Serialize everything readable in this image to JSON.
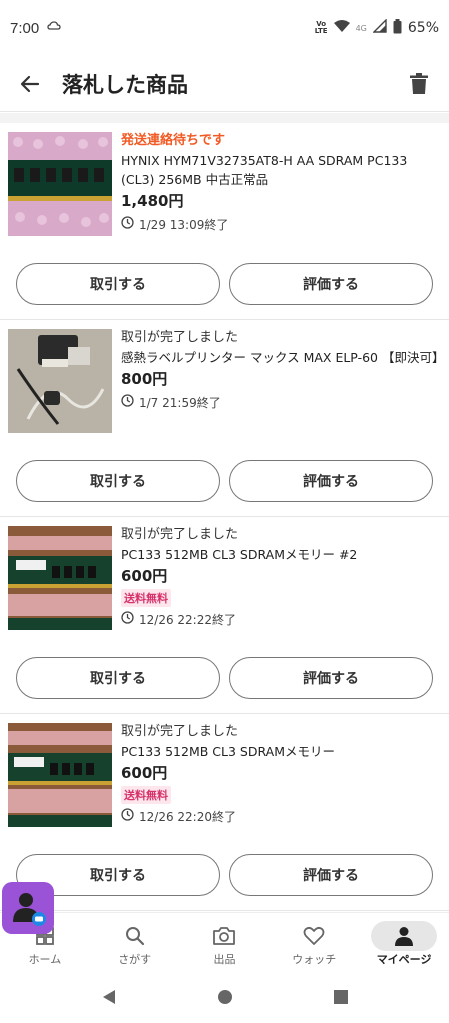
{
  "status_bar": {
    "time": "7:00",
    "lte_top": "Vo",
    "lte_bottom": "LTE",
    "network": "4G",
    "battery": "65%"
  },
  "header": {
    "title": "落札した商品"
  },
  "items": [
    {
      "status": "発送連絡待ちです",
      "name": "HYNIX HYM71V32735AT8-H AA SDRAM PC133 (CL3) 256MB 中古正常品",
      "price": "1,480円",
      "badge": "",
      "end": "1/29 13:09終了",
      "btn_trade": "取引する",
      "btn_rate": "評価する"
    },
    {
      "status": "取引が完了しました",
      "name": "感熱ラベルプリンター マックス MAX ELP-60 【即決可】",
      "price": "800円",
      "badge": "",
      "end": "1/7 21:59終了",
      "btn_trade": "取引する",
      "btn_rate": "評価する"
    },
    {
      "status": "取引が完了しました",
      "name": "PC133 512MB CL3 SDRAMメモリー #2",
      "price": "600円",
      "badge": "送料無料",
      "end": "12/26 22:22終了",
      "btn_trade": "取引する",
      "btn_rate": "評価する"
    },
    {
      "status": "取引が完了しました",
      "name": "PC133 512MB CL3 SDRAMメモリー",
      "price": "600円",
      "badge": "送料無料",
      "end": "12/26 22:20終了",
      "btn_trade": "取引する",
      "btn_rate": "評価する"
    }
  ],
  "nav": {
    "home": "ホーム",
    "search": "さがす",
    "sell": "出品",
    "watch": "ウォッチ",
    "mypage": "マイページ"
  },
  "colors": {
    "warn": "#f15a24",
    "badge_text": "#d6336c",
    "badge_bg": "#fde7ec",
    "fab": "#9a52d6"
  }
}
